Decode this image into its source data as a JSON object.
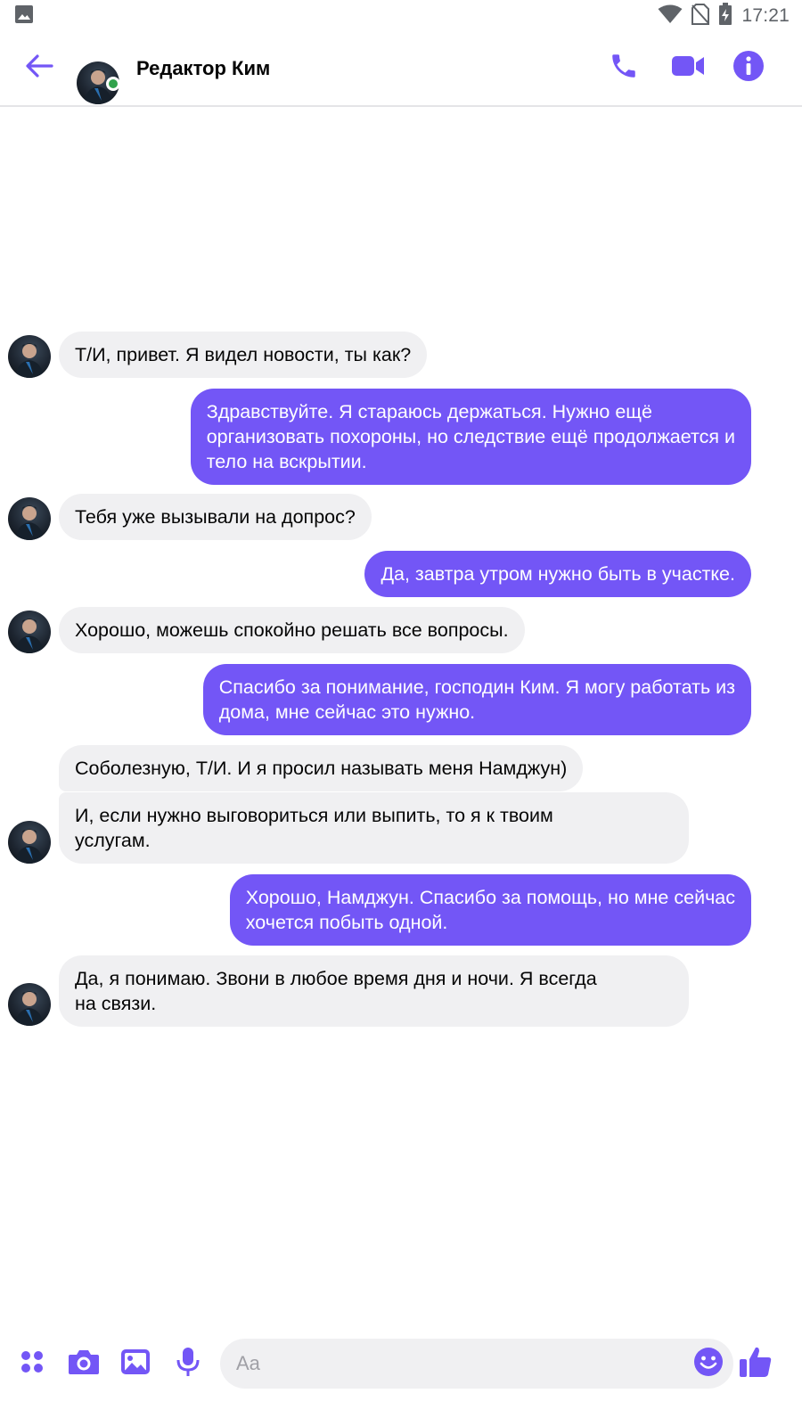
{
  "status_bar": {
    "time": "17:21",
    "icons": [
      "gallery-icon",
      "wifi-icon",
      "no-sim-icon",
      "battery-charging-icon"
    ]
  },
  "header": {
    "contact_name": "Редактор Ким",
    "online": true,
    "actions": [
      "phone-icon",
      "video-camera-icon",
      "info-icon"
    ]
  },
  "messages": [
    {
      "direction": "in",
      "lines": [
        "Т/И, привет. Я видел новости, ты как?"
      ]
    },
    {
      "direction": "out",
      "lines": [
        "Здравствуйте. Я стараюсь держаться. Нужно ещё",
        "организовать похороны, но следствие ещё продолжается и",
        "тело на вскрытии."
      ]
    },
    {
      "direction": "in",
      "lines": [
        "Тебя уже вызывали на допрос?"
      ]
    },
    {
      "direction": "out",
      "lines": [
        "Да, завтра утром нужно быть в участке."
      ]
    },
    {
      "direction": "in",
      "lines": [
        "Хорошо, можешь спокойно решать все вопросы."
      ]
    },
    {
      "direction": "out",
      "lines": [
        "Спасибо за понимание, господин Ким. Я могу работать из",
        "дома, мне сейчас это нужно."
      ]
    },
    {
      "direction": "in",
      "lines": [
        "Соболезную, Т/И. И я просил называть меня Намджун)"
      ]
    },
    {
      "direction": "in",
      "lines": [
        "И, если нужно выговориться или выпить, то я к твоим",
        "услугам."
      ]
    },
    {
      "direction": "out",
      "lines": [
        "Хорошо, Намджун. Спасибо за помощь, но мне сейчас",
        "хочется побыть одной."
      ]
    },
    {
      "direction": "in",
      "lines": [
        "Да, я понимаю. Звони в любое время дня и ночи. Я всегда",
        "на связи."
      ]
    }
  ],
  "composer": {
    "placeholder": "Aa",
    "value": "",
    "actions": [
      "apps-icon",
      "camera-icon",
      "image-icon",
      "microphone-icon",
      "emoji-icon",
      "thumbs-up-icon"
    ]
  },
  "colors": {
    "accent": "#7356f6",
    "incoming_bubble": "#f0f0f2",
    "online": "#31a24c"
  }
}
